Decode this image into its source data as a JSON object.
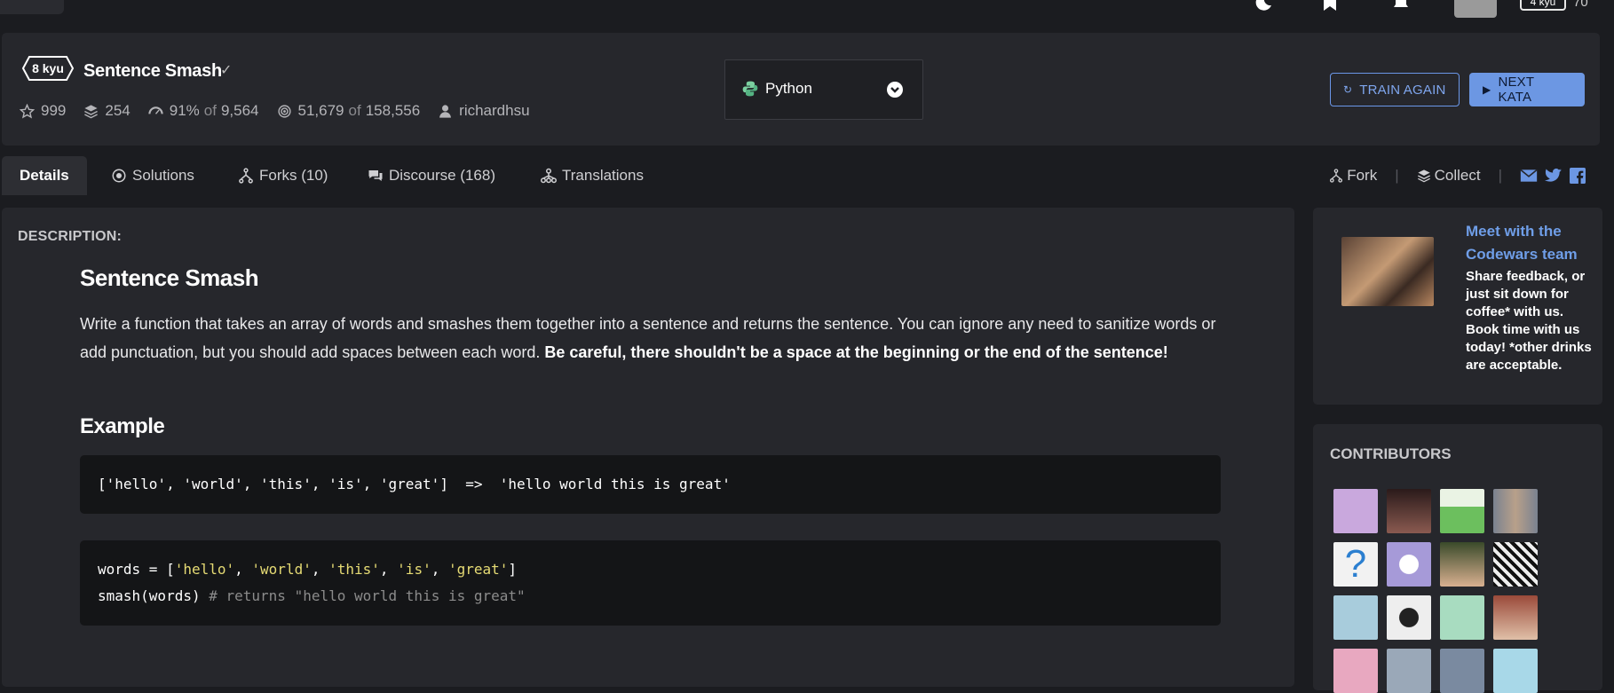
{
  "topbar": {
    "rank_label": "4 kyu",
    "honor": "70"
  },
  "kata": {
    "kyu_label": "8 kyu",
    "title": "Sentence Smash",
    "stats": {
      "stars": "999",
      "collections": "254",
      "satisfaction_pct": "91%",
      "satisfaction_of": "of",
      "satisfaction_total": "9,564",
      "completed": "51,679",
      "completed_of": "of",
      "completed_total": "158,556",
      "author": "richardhsu"
    }
  },
  "language": {
    "selected": "Python"
  },
  "actions": {
    "train_again": "TRAIN AGAIN",
    "next_kata": "NEXT KATA"
  },
  "tabs": [
    {
      "label": "Details"
    },
    {
      "label": "Solutions"
    },
    {
      "label": "Forks (10)"
    },
    {
      "label": "Discourse (168)"
    },
    {
      "label": "Translations"
    }
  ],
  "tab_actions": {
    "fork": "Fork",
    "collect": "Collect",
    "sep": "|"
  },
  "description": {
    "label": "DESCRIPTION:",
    "heading": "Sentence Smash",
    "paragraph_plain": "Write a function that takes an array of words and smashes them together into a sentence and returns the sentence. You can ignore any need to sanitize words or add punctuation, but you should add spaces between each word. ",
    "paragraph_bold": "Be careful, there shouldn't be a space at the beginning or the end of the sentence!",
    "example_heading": "Example",
    "example_line": "['hello', 'world', 'this', 'is', 'great']  =>  'hello world this is great'",
    "code_line1_a": "words = [",
    "code_line1_s1": "'hello'",
    "code_line1_s2": "'world'",
    "code_line1_s3": "'this'",
    "code_line1_s4": "'is'",
    "code_line1_s5": "'great'",
    "code_line1_sep": ", ",
    "code_line1_end": "]",
    "code_line2_a": "smash(words) ",
    "code_line2_comment": "# returns \"hello world this is great\""
  },
  "ad": {
    "title": "Meet with the Codewars team",
    "text": "Share feedback, or just sit down for coffee* with us. Book time with us today! *other drinks are acceptable."
  },
  "contributors": {
    "heading": "CONTRIBUTORS"
  },
  "colors": {
    "accent": "#6c97e3",
    "background": "#1b1c20",
    "panel": "#26272c"
  }
}
